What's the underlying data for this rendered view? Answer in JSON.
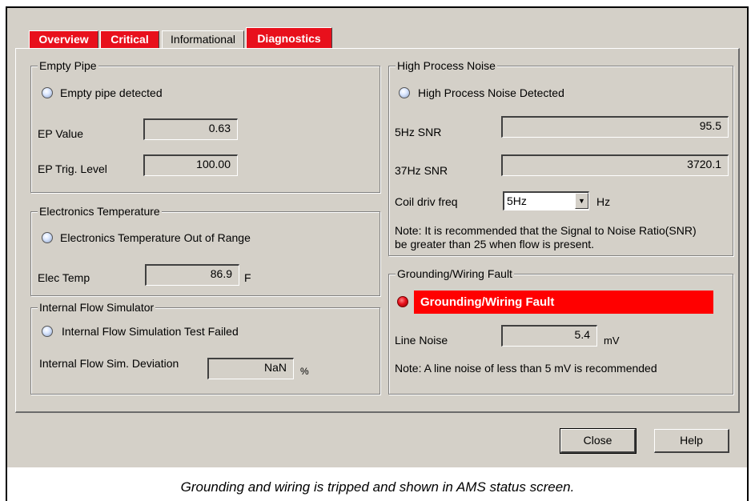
{
  "tabs": [
    {
      "label": "Overview",
      "style": "red"
    },
    {
      "label": "Critical",
      "style": "red"
    },
    {
      "label": "Informational",
      "style": "plain"
    },
    {
      "label": "Diagnostics",
      "style": "red"
    }
  ],
  "empty_pipe": {
    "title": "Empty Pipe",
    "indicator_label": "Empty pipe detected",
    "ep_value_label": "EP Value",
    "ep_value": "0.63",
    "trig_label": "EP Trig. Level",
    "trig_value": "100.00"
  },
  "electronics_temp": {
    "title": "Electronics Temperature",
    "indicator_label": "Electronics Temperature Out of Range",
    "elec_temp_label": "Elec Temp",
    "elec_temp_value": "86.9",
    "elec_temp_unit": "F"
  },
  "flow_simulator": {
    "title": "Internal Flow Simulator",
    "indicator_label": "Internal Flow Simulation Test Failed",
    "deviation_label": "Internal Flow Sim. Deviation",
    "deviation_value": "NaN",
    "deviation_unit": "%"
  },
  "process_noise": {
    "title": "High Process Noise",
    "indicator_label": "High Process Noise Detected",
    "snr5_label": "5Hz SNR",
    "snr5_value": "95.5",
    "snr37_label": "37Hz SNR",
    "snr37_value": "3720.1",
    "coil_label": "Coil driv freq",
    "coil_value": "5Hz",
    "coil_unit": "Hz",
    "note_line1": "Note: It is recommended that the Signal to Noise Ratio(SNR)",
    "note_line2": "be greater than 25 when flow is present."
  },
  "grounding": {
    "title": "Grounding/Wiring Fault",
    "alarm_text": "Grounding/Wiring Fault",
    "line_noise_label": "Line Noise",
    "line_noise_value": "5.4",
    "line_noise_unit": "mV",
    "note": "Note: A line noise of less than 5 mV is recommended"
  },
  "buttons": {
    "close": "Close",
    "help": "Help"
  },
  "caption": "Grounding and wiring is tripped and shown in AMS status screen.",
  "colors": {
    "alarm_red": "#ff0000",
    "tab_red": "#e8101c",
    "dialog_gray": "#d4d0c8"
  }
}
